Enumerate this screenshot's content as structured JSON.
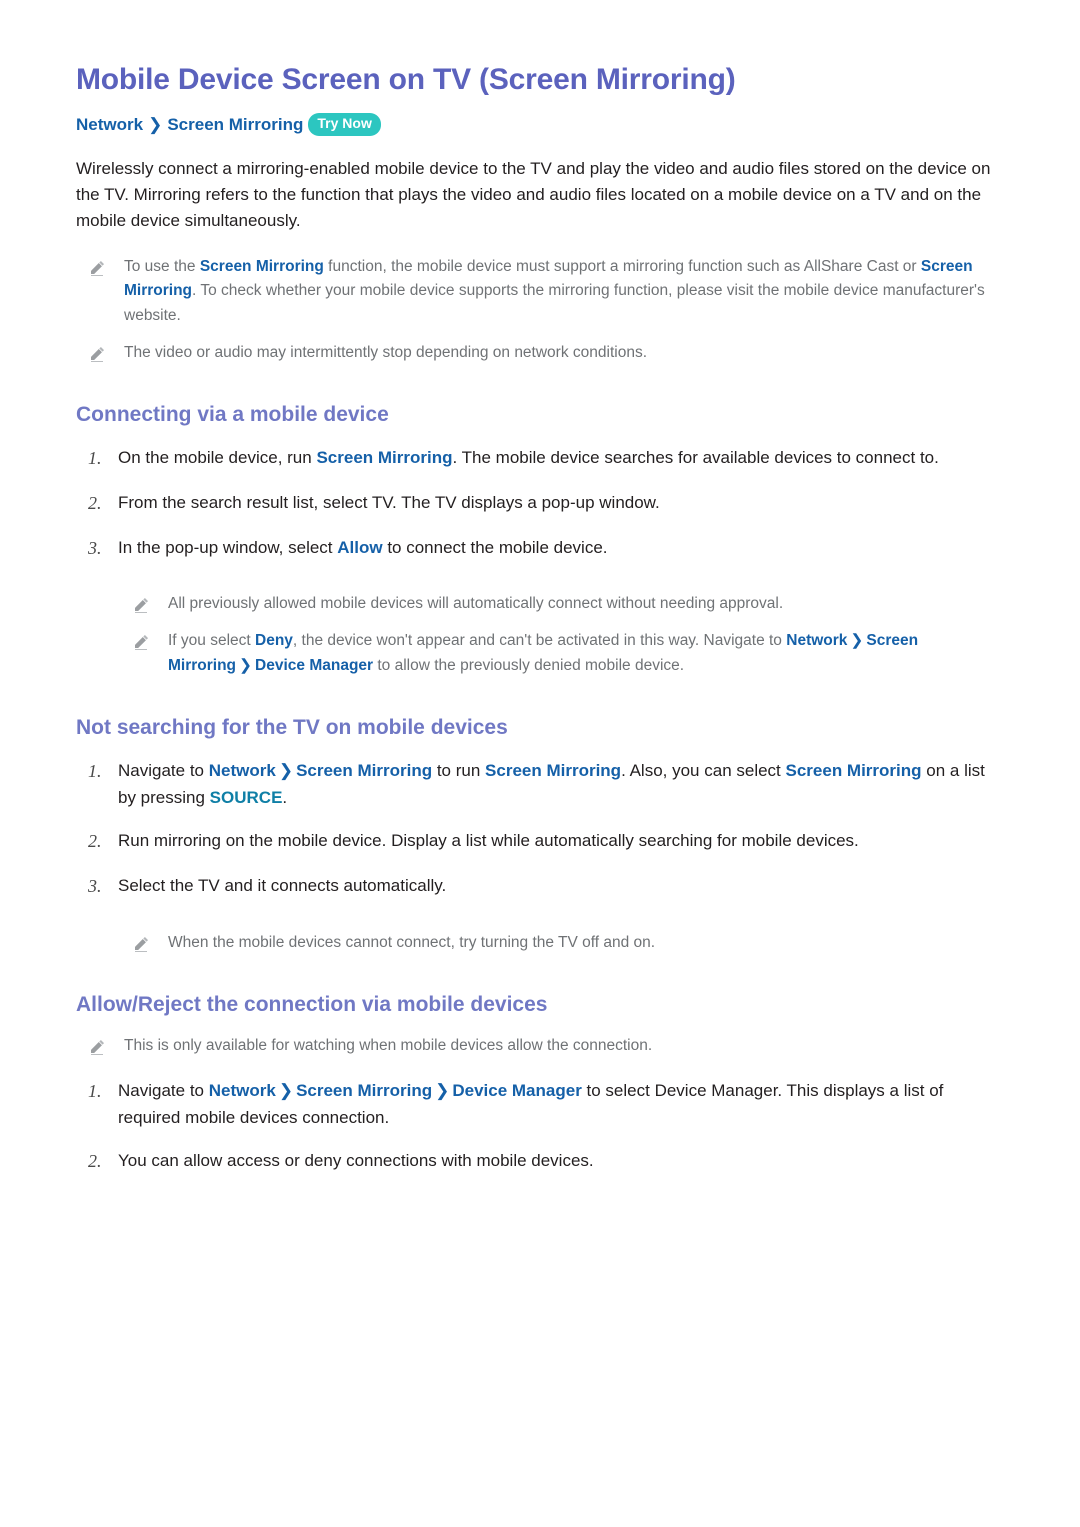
{
  "page": {
    "title": "Mobile Device Screen on TV (Screen Mirroring)",
    "colors": {
      "title": "#5b62bd",
      "section_heading": "#7078c4",
      "link": "#1560a8",
      "link_alt": "#0f7fa6",
      "badge_bg": "#2cc6c0",
      "note_text": "#6f7275",
      "body_text": "#231f20"
    }
  },
  "breadcrumb": {
    "items": [
      "Network",
      "Screen Mirroring"
    ],
    "separator": "❯",
    "badge": "Try Now"
  },
  "intro": {
    "paragraph": "Wirelessly connect a mirroring-enabled mobile device to the TV and play the video and audio files stored on the device on the TV. Mirroring refers to the function that plays the video and audio files located on a mobile device on a TV and on the mobile device simultaneously."
  },
  "intro_notes": [
    {
      "icon": "pencil-icon",
      "parts": [
        {
          "t": "To use the ",
          "s": "plain"
        },
        {
          "t": "Screen Mirroring",
          "s": "link"
        },
        {
          "t": " function, the mobile device must support a mirroring function such as AllShare Cast or ",
          "s": "plain"
        },
        {
          "t": "Screen Mirroring",
          "s": "link"
        },
        {
          "t": ". To check whether your mobile device supports the mirroring function, please visit the mobile device manufacturer's website.",
          "s": "plain"
        }
      ]
    },
    {
      "icon": "pencil-icon",
      "parts": [
        {
          "t": "The video or audio may intermittently stop depending on network conditions.",
          "s": "plain"
        }
      ]
    }
  ],
  "sections": [
    {
      "heading": "Connecting via a mobile device",
      "steps": [
        {
          "num": "1.",
          "parts": [
            {
              "t": "On the mobile device, run ",
              "s": "plain"
            },
            {
              "t": "Screen Mirroring",
              "s": "link"
            },
            {
              "t": ". The mobile device searches for available devices to connect to.",
              "s": "plain"
            }
          ]
        },
        {
          "num": "2.",
          "parts": [
            {
              "t": "From the search result list, select TV. The TV displays a pop-up window.",
              "s": "plain"
            }
          ]
        },
        {
          "num": "3.",
          "parts": [
            {
              "t": "In the pop-up window, select ",
              "s": "plain"
            },
            {
              "t": "Allow",
              "s": "link"
            },
            {
              "t": " to connect the mobile device.",
              "s": "plain"
            }
          ]
        }
      ],
      "notes": [
        {
          "icon": "pencil-icon",
          "indent": true,
          "parts": [
            {
              "t": "All previously allowed mobile devices will automatically connect without needing approval.",
              "s": "plain"
            }
          ]
        },
        {
          "icon": "pencil-icon",
          "indent": true,
          "parts": [
            {
              "t": "If you select ",
              "s": "plain"
            },
            {
              "t": "Deny",
              "s": "link"
            },
            {
              "t": ", the device won't appear and can't be activated in this way. Navigate to ",
              "s": "plain"
            },
            {
              "t": "Network",
              "s": "link"
            },
            {
              "t": "❯",
              "s": "sep"
            },
            {
              "t": "Screen Mirroring",
              "s": "link"
            },
            {
              "t": "❯",
              "s": "sep"
            },
            {
              "t": "Device Manager",
              "s": "link"
            },
            {
              "t": " to allow the previously denied mobile device.",
              "s": "plain"
            }
          ]
        }
      ]
    },
    {
      "heading": "Not searching for the TV on mobile devices",
      "steps": [
        {
          "num": "1.",
          "parts": [
            {
              "t": "Navigate to ",
              "s": "plain"
            },
            {
              "t": "Network",
              "s": "link"
            },
            {
              "t": "❯",
              "s": "sep"
            },
            {
              "t": "Screen Mirroring",
              "s": "link"
            },
            {
              "t": " to run ",
              "s": "plain"
            },
            {
              "t": "Screen Mirroring",
              "s": "link"
            },
            {
              "t": ". Also, you can select ",
              "s": "plain"
            },
            {
              "t": "Screen Mirroring",
              "s": "link"
            },
            {
              "t": " on a list by pressing ",
              "s": "plain"
            },
            {
              "t": "SOURCE",
              "s": "link_alt"
            },
            {
              "t": ".",
              "s": "plain"
            }
          ]
        },
        {
          "num": "2.",
          "parts": [
            {
              "t": "Run mirroring on the mobile device. Display a list while automatically searching for mobile devices.",
              "s": "plain"
            }
          ]
        },
        {
          "num": "3.",
          "parts": [
            {
              "t": "Select the TV and it connects automatically.",
              "s": "plain"
            }
          ]
        }
      ],
      "notes": [
        {
          "icon": "pencil-icon",
          "indent": true,
          "parts": [
            {
              "t": "When the mobile devices cannot connect, try turning the TV off and on.",
              "s": "plain"
            }
          ]
        }
      ]
    },
    {
      "heading": "Allow/Reject the connection via mobile devices",
      "notes_before": [
        {
          "icon": "pencil-icon",
          "indent": false,
          "parts": [
            {
              "t": "This is only available for watching when mobile devices allow the connection.",
              "s": "plain"
            }
          ]
        }
      ],
      "steps": [
        {
          "num": "1.",
          "parts": [
            {
              "t": "Navigate to ",
              "s": "plain"
            },
            {
              "t": "Network",
              "s": "link"
            },
            {
              "t": "❯",
              "s": "sep"
            },
            {
              "t": "Screen Mirroring",
              "s": "link"
            },
            {
              "t": "❯",
              "s": "sep"
            },
            {
              "t": "Device Manager",
              "s": "link"
            },
            {
              "t": " to select Device Manager. This displays a list of required mobile devices connection.",
              "s": "plain"
            }
          ]
        },
        {
          "num": "2.",
          "parts": [
            {
              "t": "You can allow access or deny connections with mobile devices.",
              "s": "plain"
            }
          ]
        }
      ]
    }
  ]
}
